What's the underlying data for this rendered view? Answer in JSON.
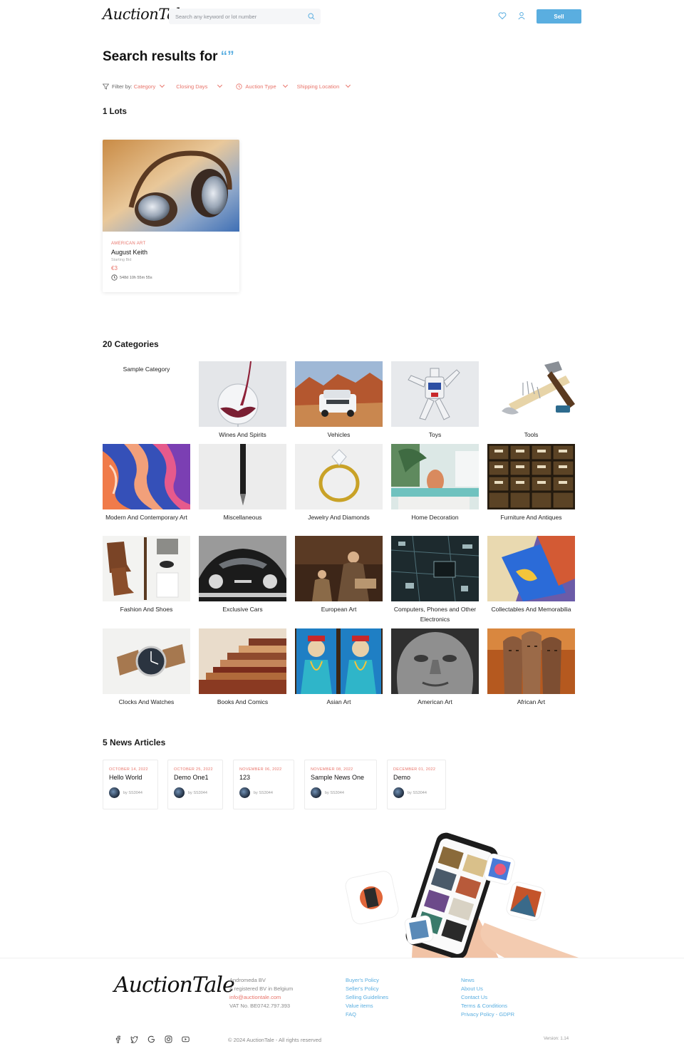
{
  "header": {
    "logo_text": "AuctionTale",
    "search_placeholder": "Search any keyword or lot number",
    "sell_label": "Sell"
  },
  "results": {
    "title": "Search results for",
    "query_mark": "“”"
  },
  "filters": {
    "label": "Filter by:",
    "items": [
      "Category",
      "Closing Days",
      "Auction Type",
      "Shipping Location"
    ]
  },
  "lots": {
    "count_label": "1 Lots",
    "items": [
      {
        "category": "AMERICAN ART",
        "title": "August Keith",
        "bid_label": "Starting Bid",
        "price": "€3",
        "time_left": "548d 10h 55m 55s"
      }
    ]
  },
  "categories": {
    "heading": "20 Categories",
    "items": [
      "Sample Category",
      "Wines And Spirits",
      "Vehicles",
      "Toys",
      "Tools",
      "Modern And Contemporary Art",
      "Miscellaneous",
      "Jewelry And Diamonds",
      "Home Decoration",
      "Furniture And Antiques",
      "Fashion And Shoes",
      "Exclusive Cars",
      "European Art",
      "Computers, Phones and Other Electronics",
      "Collectables And Memorabilia",
      "Clocks And Watches",
      "Books And Comics",
      "Asian Art",
      "American Art",
      "African Art"
    ]
  },
  "news": {
    "heading": "5 News Articles",
    "items": [
      {
        "date": "OCTOBER 14, 2022",
        "title": "Hello World",
        "author": "by SS3044"
      },
      {
        "date": "OCTOBER 25, 2022",
        "title": "Demo One1",
        "author": "by SS3044"
      },
      {
        "date": "NOVEMBER 06, 2022",
        "title": "123",
        "author": "by SS3044"
      },
      {
        "date": "NOVEMBER 08, 2022",
        "title": "Sample News One",
        "author": "by SS3044"
      },
      {
        "date": "DECEMBER 01, 2022",
        "title": "Demo",
        "author": "by SS3044"
      }
    ]
  },
  "footer": {
    "logo_text": "AuctionTale",
    "company": {
      "name": "Andromeda BV",
      "registration": "A registered BV in Belgium",
      "email": "info@auctiontale.com",
      "vat": "VAT No. BE0742.797.393"
    },
    "links_col1": [
      "Buyer's Policy",
      "Seller's Policy",
      "Selling Guidelines",
      "Value items",
      "FAQ"
    ],
    "links_col2": [
      "News",
      "About Us",
      "Contact Us",
      "Terms & Conditions",
      "Privacy Policy - GDPR"
    ],
    "copyright": "© 2024 AuctionTale - All rights reserved",
    "version": "Version: 1.14",
    "social_icons": [
      "facebook-icon",
      "twitter-icon",
      "google-icon",
      "instagram-icon",
      "youtube-icon"
    ]
  },
  "colors": {
    "accent_blue": "#5aaee0",
    "accent_red": "#e8746a"
  }
}
